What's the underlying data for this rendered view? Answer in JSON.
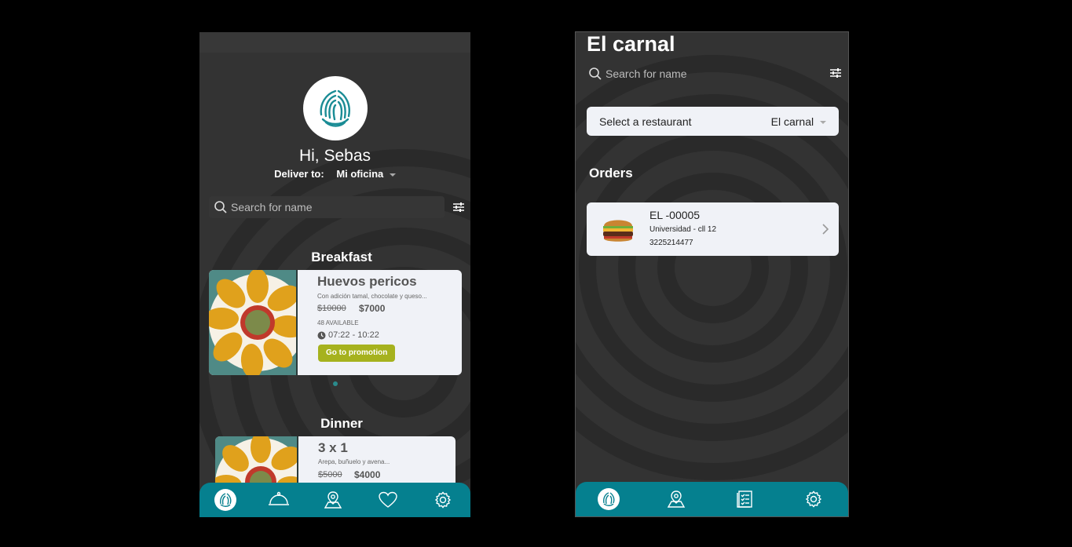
{
  "home_screen": {
    "greeting": "Hi, Sebas",
    "deliver_label": "Deliver to:",
    "deliver_address": "Mi oficina",
    "search": {
      "placeholder": "Search for name"
    },
    "sections": [
      {
        "title": "Breakfast",
        "promo": {
          "name": "Huevos pericos",
          "description": "Con adición tamal, chocolate y queso...",
          "old_price": "$10000",
          "new_price": "$7000",
          "availability": "48 AVAILABLE",
          "time": "07:22 - 10:22",
          "button": "Go to promotion"
        }
      },
      {
        "title": "Dinner",
        "promo": {
          "name": "3 x 1",
          "description": "Arepa, buñuelo y avena...",
          "old_price": "$5000",
          "new_price": "$4000"
        }
      }
    ],
    "nav": [
      "home-logo-icon",
      "dish-cover-icon",
      "map-pin-icon",
      "heart-icon",
      "gear-icon"
    ]
  },
  "orders_screen": {
    "title": "El carnal",
    "search": {
      "placeholder": "Search for name"
    },
    "restaurant_select": {
      "label": "Select a restaurant",
      "value": "El carnal"
    },
    "orders_title": "Orders",
    "orders": [
      {
        "code": "EL -00005",
        "address": "Universidad - cll 12",
        "phone": "3225214477",
        "image": "burger-icon"
      }
    ],
    "nav": [
      "home-logo-icon",
      "map-pin-icon",
      "order-list-icon",
      "gear-icon"
    ]
  },
  "colors": {
    "accent": "#05808f",
    "promo_button": "#a6b21e",
    "background": "#333333"
  }
}
